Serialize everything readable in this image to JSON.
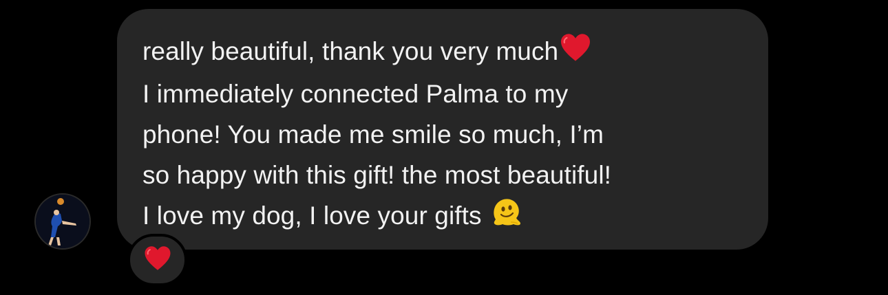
{
  "message": {
    "lines": [
      "really beautiful, thank you very much",
      "I immediately connected Palma to my",
      "phone! You made me smile so much, I’m",
      "so happy with this gift! the most beautiful!",
      "I love my dog, I love your gifts"
    ],
    "emojis": {
      "line1_end": "red-heart",
      "line5_end": "melting-face"
    }
  },
  "reaction": {
    "emoji": "red-heart"
  },
  "sender": {
    "avatar": "profile-photo-volleyball-player"
  },
  "colors": {
    "background": "#000000",
    "bubble": "#262626",
    "text": "#f2f2f2",
    "heart": "#e0182d",
    "melting_face": "#f5c518"
  }
}
